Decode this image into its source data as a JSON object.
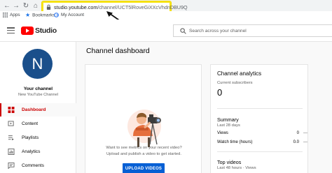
{
  "browser": {
    "url_host": "studio.youtube.com",
    "url_path": "/channel/UCT5lRoveGiXXcVhdnDBU9Q",
    "bookmarks": [
      {
        "label": "Apps"
      },
      {
        "label": "Bookmarks"
      },
      {
        "label": "My Account"
      }
    ]
  },
  "callout": {
    "number": "1"
  },
  "header": {
    "brand": "Studio",
    "search_placeholder": "Search across your channel"
  },
  "sidebar": {
    "avatar_letter": "N",
    "channel_title": "Your channel",
    "channel_name": "New YouTube Channel",
    "items": [
      {
        "label": "Dashboard",
        "icon": "dashboard-icon",
        "active": true
      },
      {
        "label": "Content",
        "icon": "content-icon"
      },
      {
        "label": "Playlists",
        "icon": "playlists-icon"
      },
      {
        "label": "Analytics",
        "icon": "analytics-icon"
      },
      {
        "label": "Comments",
        "icon": "comments-icon"
      }
    ]
  },
  "main": {
    "title": "Channel dashboard",
    "upload_card": {
      "line1": "Want to see metrics on your recent video?",
      "line2": "Upload and publish a video to get started.",
      "button": "UPLOAD VIDEOS"
    },
    "analytics": {
      "title": "Channel analytics",
      "subscribers_label": "Current subscribers",
      "subscribers_value": "0",
      "summary_title": "Summary",
      "summary_period": "Last 28 days",
      "rows": [
        {
          "label": "Views",
          "value": "0",
          "trend": "—"
        },
        {
          "label": "Watch time (hours)",
          "value": "0.0",
          "trend": "—"
        }
      ],
      "top_videos_title": "Top videos",
      "top_videos_period": "Last 48 hours · Views"
    }
  },
  "colors": {
    "accent_red": "#cc0000",
    "youtube_red": "#ff0000",
    "button_blue": "#065fd4",
    "highlight_yellow": "#f7e51b",
    "avatar_blue": "#1a4f8b"
  }
}
